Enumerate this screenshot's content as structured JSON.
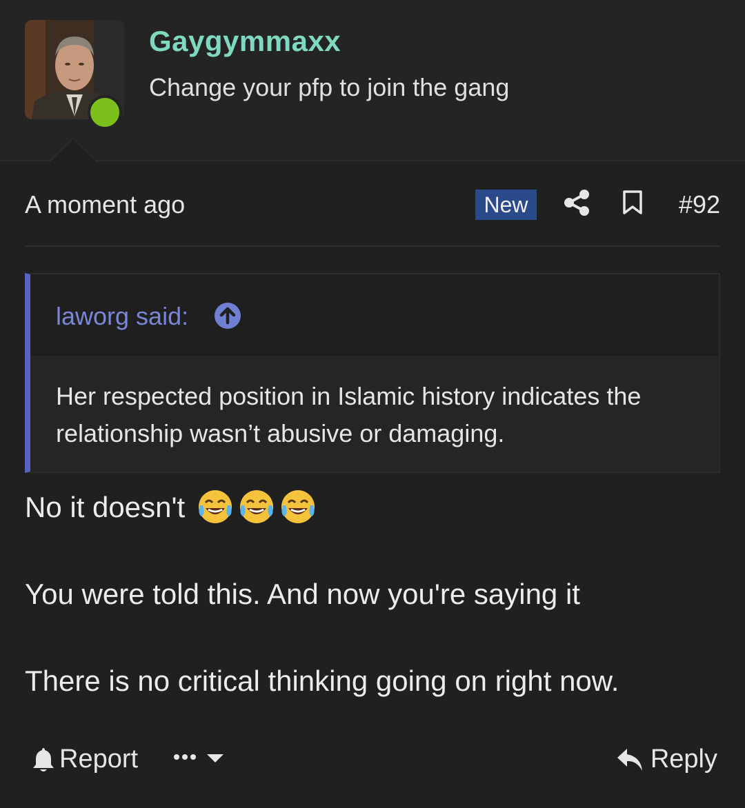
{
  "user": {
    "name": "Gaygymmaxx",
    "title": "Change your pfp to join the gang",
    "status_color": "#7cbf1a",
    "name_color": "#7fd8c0"
  },
  "post": {
    "time": "A moment ago",
    "badge": "New",
    "number": "#92"
  },
  "quote": {
    "author": "laworg said:",
    "text": "Her respected position in Islamic history indicates the relationship wasn’t abusive or damaging."
  },
  "message": {
    "line1": "No it doesn't",
    "line1_emoji": [
      "face-with-tears-of-joy",
      "face-with-tears-of-joy",
      "face-with-tears-of-joy"
    ],
    "line2": "You were told this. And now you're saying it",
    "line3": "There is no critical thinking going on right now."
  },
  "actions": {
    "report": "Report",
    "reply": "Reply"
  },
  "colors": {
    "background": "#202020",
    "badge": "#2a4a8c",
    "quote_accent": "#5a62c4"
  }
}
